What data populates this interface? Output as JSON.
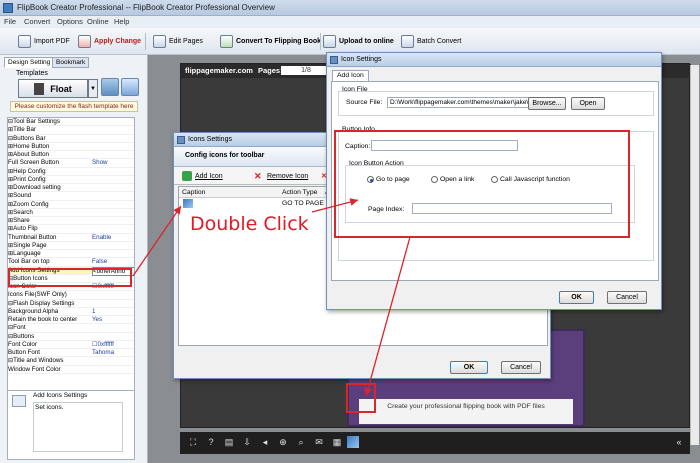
{
  "window": {
    "title": "FlipBook Creator Professional  -- FlipBook Creator Professional Overview"
  },
  "menu": [
    "File",
    "Convert",
    "Options",
    "Online",
    "Help"
  ],
  "toolbar": {
    "import_pdf": "Import PDF",
    "apply_change": "Apply Change",
    "edit_pages": "Edit Pages",
    "convert": "Convert To Flipping Book",
    "upload": "Upload to online",
    "batch": "Batch Convert"
  },
  "left_panel": {
    "tabs": [
      "Design Setting",
      "Bookmark"
    ],
    "templates_label": "Templates",
    "template_name": "Float",
    "customize_hint": "Please customize the flash template here",
    "properties": [
      {
        "k": "⊟Tool Bar Settings",
        "v": ""
      },
      {
        "k": " ⊞Title Bar",
        "v": ""
      },
      {
        "k": " ⊟Buttons Bar",
        "v": ""
      },
      {
        "k": "   ⊞Home Button",
        "v": ""
      },
      {
        "k": "   ⊞About Button",
        "v": ""
      },
      {
        "k": "     Full Screen Button",
        "v": "Show"
      },
      {
        "k": "   ⊞Help Config",
        "v": ""
      },
      {
        "k": "   ⊞Print Config",
        "v": ""
      },
      {
        "k": "   ⊞Download setting",
        "v": ""
      },
      {
        "k": "   ⊞Sound",
        "v": ""
      },
      {
        "k": "   ⊞Zoom Config",
        "v": ""
      },
      {
        "k": "   ⊞Search",
        "v": ""
      },
      {
        "k": "   ⊞Share",
        "v": ""
      },
      {
        "k": "   ⊞Auto Flip",
        "v": ""
      },
      {
        "k": "     Thumbnail Button",
        "v": "Enable"
      },
      {
        "k": "   ⊞Single Page",
        "v": ""
      },
      {
        "k": "   ⊞Language",
        "v": ""
      },
      {
        "k": "     Tool Bar on top",
        "v": "False"
      },
      {
        "k": "     Add Icons Settings",
        "v": "<otherAnno"
      },
      {
        "k": " ⊟Button Icons",
        "v": ""
      },
      {
        "k": "     Icon Color",
        "v": "☐0xffffff"
      },
      {
        "k": "     Icons File(SWF Only)",
        "v": ""
      },
      {
        "k": "⊟Flash Display Settings",
        "v": ""
      },
      {
        "k": "   Background Alpha",
        "v": "1"
      },
      {
        "k": "   Retain the book to center",
        "v": "Yes"
      },
      {
        "k": "⊟Font",
        "v": ""
      },
      {
        "k": " ⊟Buttons",
        "v": ""
      },
      {
        "k": "     Font Color",
        "v": "☐0xffffff"
      },
      {
        "k": "     Button Font",
        "v": "Tahoma"
      },
      {
        "k": " ⊟Title and Windows",
        "v": ""
      },
      {
        "k": "     Window Font Color",
        "v": ""
      }
    ],
    "highlight_index": 18,
    "desc_title": "Add Icons Settings",
    "desc_text": "Set icons."
  },
  "viewer": {
    "site": "flippagemaker.com",
    "pages_label": "Pages:",
    "page_value": "1/8",
    "book_caption": "Create your professional flipping book with PDF files"
  },
  "icons_dialog": {
    "title": "Icons Settings",
    "header": "Config icons for toolbar",
    "add_icon": "Add Icon",
    "remove_icon": "Remove Icon",
    "col_caption": "Caption",
    "col_action": "Action Type",
    "col_action2": "Ac",
    "row_action": "GO TO PAGE",
    "ok": "OK",
    "cancel": "Cancel"
  },
  "icon_dialog": {
    "title": "Icon Settings",
    "tab": "Add Icon",
    "icon_file_group": "Icon File",
    "source_label": "Source File:",
    "source_value": "D:\\Work\\flippagemaker.com\\themes\\maker\\jake\\pc",
    "browse": "Browse...",
    "open": "Open",
    "button_info_group": "Button Info",
    "caption_label": "Caption:",
    "action_group": "Icon Button Action",
    "opt_goto": "Go to page",
    "opt_link": "Open a link",
    "opt_js": "Call Javascript function",
    "page_index_label": "Page Index:",
    "ok": "OK",
    "cancel": "Cancel"
  },
  "annotation": {
    "double_click": "Double Click",
    "color": "#d9262a"
  }
}
